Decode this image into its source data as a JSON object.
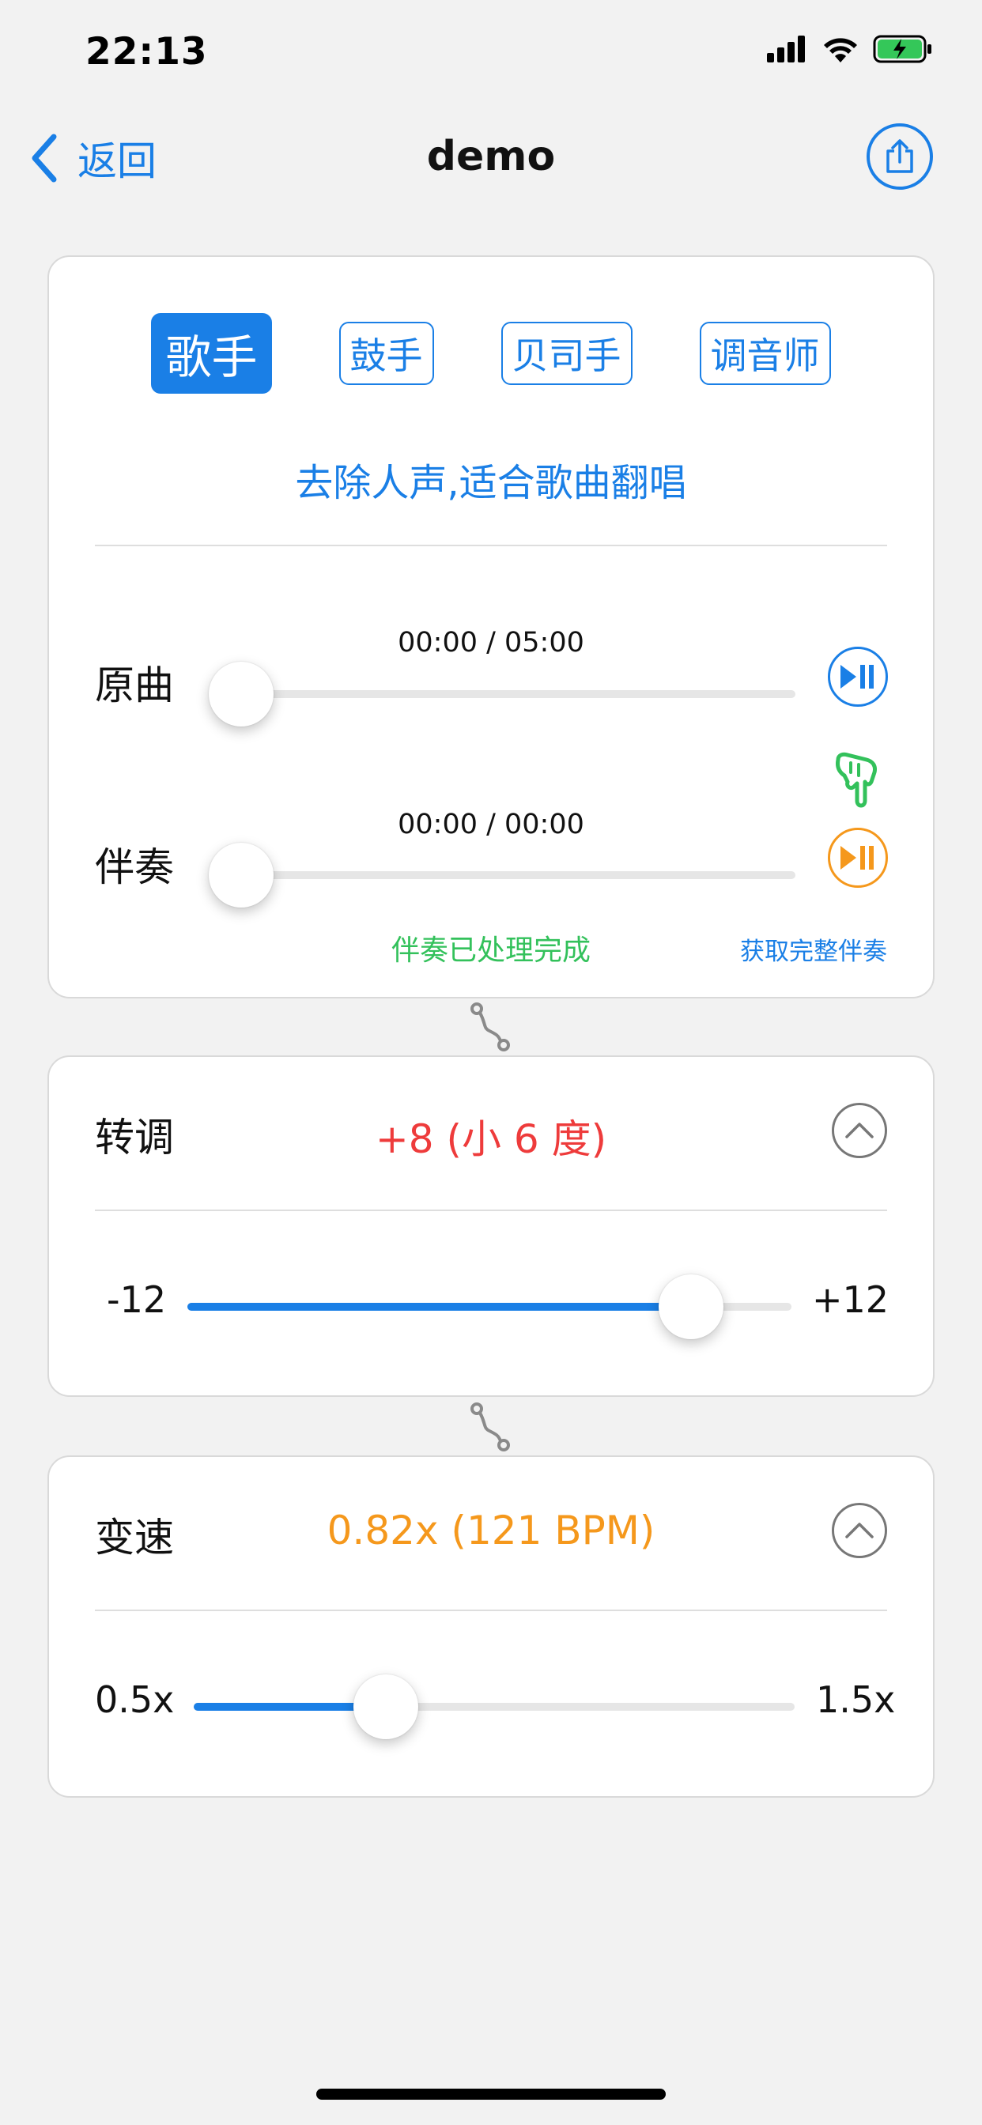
{
  "status_bar": {
    "time": "22:13"
  },
  "nav": {
    "back_label": "返回",
    "title": "demo"
  },
  "modes": {
    "tabs": [
      {
        "label": "歌手",
        "active": true
      },
      {
        "label": "鼓手",
        "active": false
      },
      {
        "label": "贝司手",
        "active": false
      },
      {
        "label": "调音师",
        "active": false
      }
    ],
    "description": "去除人声,适合歌曲翻唱"
  },
  "original_track": {
    "label": "原曲",
    "time": "00:00 / 05:00",
    "progress": 0
  },
  "accompaniment_track": {
    "label": "伴奏",
    "time": "00:00 / 00:00",
    "progress": 0
  },
  "accompaniment_status": "伴奏已处理完成",
  "get_full_accompaniment": "获取完整伴奏",
  "transpose": {
    "label": "转调",
    "value_text": "+8 (小 6 度)",
    "min_label": "-12",
    "max_label": "+12",
    "value": 8,
    "min": -12,
    "max": 12
  },
  "speed": {
    "label": "变速",
    "value_text": "0.82x (121 BPM)",
    "min_label": "0.5x",
    "max_label": "1.5x",
    "value": 0.82,
    "min": 0.5,
    "max": 1.5
  },
  "colors": {
    "accent": "#1a7fe6",
    "transpose_value": "#ee3b3b",
    "speed_value": "#f5981c",
    "success": "#33c15b"
  }
}
